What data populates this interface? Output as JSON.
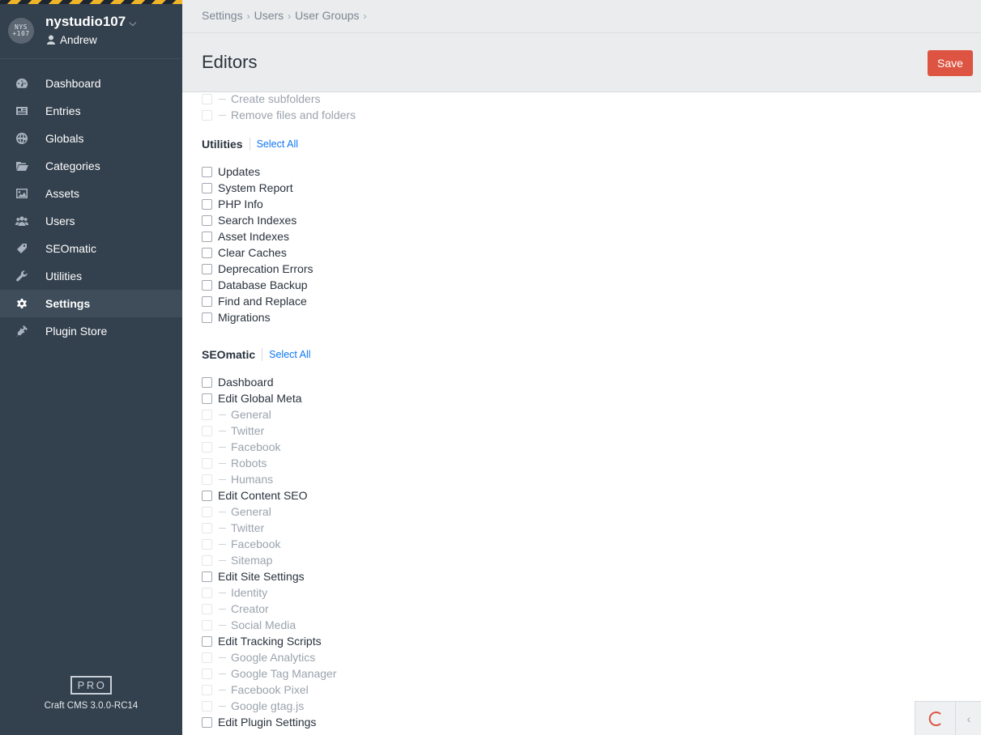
{
  "site": {
    "logo_text": "NYS\n+107",
    "name": "nystudio107",
    "user": "Andrew"
  },
  "nav": [
    {
      "label": "Dashboard",
      "icon": "dashboard-icon"
    },
    {
      "label": "Entries",
      "icon": "newspaper-icon"
    },
    {
      "label": "Globals",
      "icon": "globe-icon"
    },
    {
      "label": "Categories",
      "icon": "folder-open-icon"
    },
    {
      "label": "Assets",
      "icon": "image-icon"
    },
    {
      "label": "Users",
      "icon": "users-icon"
    },
    {
      "label": "SEOmatic",
      "icon": "seomatic-icon"
    },
    {
      "label": "Utilities",
      "icon": "wrench-icon"
    },
    {
      "label": "Settings",
      "icon": "gear-icon",
      "active": true
    },
    {
      "label": "Plugin Store",
      "icon": "plug-icon"
    }
  ],
  "edition": "PRO",
  "version": "Craft CMS 3.0.0-RC14",
  "breadcrumbs": [
    "Settings",
    "Users",
    "User Groups"
  ],
  "title": "Editors",
  "save_label": "Save",
  "top_items": [
    {
      "label": "Create subfolders",
      "disabled": true
    },
    {
      "label": "Remove files and folders",
      "disabled": true
    }
  ],
  "sections": [
    {
      "heading": "Utilities",
      "select_all": "Select All",
      "items": [
        {
          "label": "Updates"
        },
        {
          "label": "System Report"
        },
        {
          "label": "PHP Info"
        },
        {
          "label": "Search Indexes"
        },
        {
          "label": "Asset Indexes"
        },
        {
          "label": "Clear Caches"
        },
        {
          "label": "Deprecation Errors"
        },
        {
          "label": "Database Backup"
        },
        {
          "label": "Find and Replace"
        },
        {
          "label": "Migrations"
        }
      ]
    },
    {
      "heading": "SEOmatic",
      "select_all": "Select All",
      "items": [
        {
          "label": "Dashboard"
        },
        {
          "label": "Edit Global Meta"
        },
        {
          "label": "General",
          "disabled": true
        },
        {
          "label": "Twitter",
          "disabled": true
        },
        {
          "label": "Facebook",
          "disabled": true
        },
        {
          "label": "Robots",
          "disabled": true
        },
        {
          "label": "Humans",
          "disabled": true
        },
        {
          "label": "Edit Content SEO"
        },
        {
          "label": "General",
          "disabled": true
        },
        {
          "label": "Twitter",
          "disabled": true
        },
        {
          "label": "Facebook",
          "disabled": true
        },
        {
          "label": "Sitemap",
          "disabled": true
        },
        {
          "label": "Edit Site Settings"
        },
        {
          "label": "Identity",
          "disabled": true
        },
        {
          "label": "Creator",
          "disabled": true
        },
        {
          "label": "Social Media",
          "disabled": true
        },
        {
          "label": "Edit Tracking Scripts"
        },
        {
          "label": "Google Analytics",
          "disabled": true
        },
        {
          "label": "Google Tag Manager",
          "disabled": true
        },
        {
          "label": "Facebook Pixel",
          "disabled": true
        },
        {
          "label": "Google gtag.js",
          "disabled": true
        },
        {
          "label": "Edit Plugin Settings"
        }
      ]
    }
  ],
  "colors": {
    "accent": "#de5442",
    "link": "#0d78f2",
    "sidebar": "#33404d"
  }
}
